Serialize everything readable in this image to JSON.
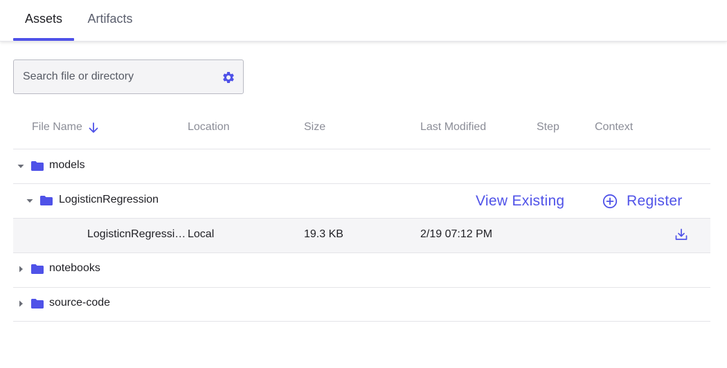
{
  "tabs": [
    {
      "label": "Assets",
      "active": true
    },
    {
      "label": "Artifacts",
      "active": false
    }
  ],
  "search": {
    "placeholder": "Search file or directory",
    "value": ""
  },
  "columns": {
    "file_name": "File Name",
    "location": "Location",
    "size": "Size",
    "last_modified": "Last Modified",
    "step": "Step",
    "context": "Context"
  },
  "tree": {
    "models": {
      "name": "models",
      "expanded": true
    },
    "logistic_folder": {
      "name": "LogisticnRegression",
      "expanded": true
    },
    "file": {
      "name": "LogisticnRegressi…",
      "location": "Local",
      "size": "19.3 KB",
      "last_modified": "2/19 07:12 PM"
    },
    "notebooks": {
      "name": "notebooks",
      "expanded": false
    },
    "source_code": {
      "name": "source-code",
      "expanded": false
    }
  },
  "actions": {
    "view_existing": "View Existing",
    "register": "Register"
  },
  "icons": {
    "settings": "gear-icon",
    "sort": "arrow-down-icon",
    "folder": "folder-icon",
    "add": "plus-circle-icon",
    "download": "download-icon"
  },
  "colors": {
    "accent": "#4f52e8",
    "folder": "#4f52e8",
    "muted_text": "#8b8d97",
    "row_highlight": "#f5f5f7"
  }
}
